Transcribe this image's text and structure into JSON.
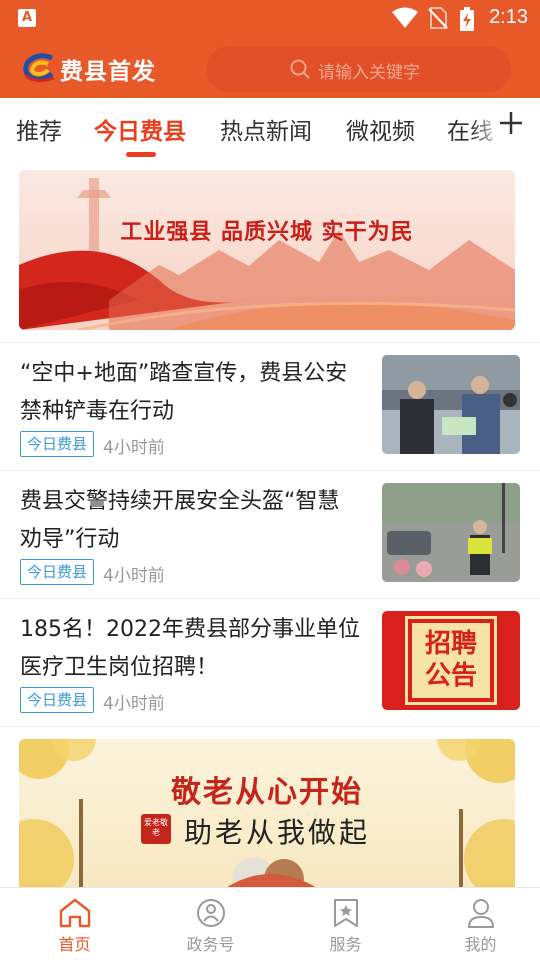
{
  "status_bar": {
    "time": "2:13",
    "icons": [
      "app-notification-icon",
      "wifi-icon",
      "no-sim-icon",
      "battery-charging-icon"
    ]
  },
  "header": {
    "app_name": "费县首发",
    "search_placeholder": "请输入关键字"
  },
  "tabs": [
    {
      "label": "推荐",
      "active": false
    },
    {
      "label": "今日费县",
      "active": true
    },
    {
      "label": "热点新闻",
      "active": false
    },
    {
      "label": "微视频",
      "active": false
    },
    {
      "label": "在线",
      "active": false
    }
  ],
  "banner_top": {
    "slogan": "工业强县 品质兴城 实干为民"
  },
  "news": [
    {
      "title": "“空中+地面”踏查宣传，费县公安禁种铲毒在行动",
      "tag": "今日费县",
      "time_ago": "4小时前"
    },
    {
      "title": "费县交警持续开展安全头盔“智慧劝导”行动",
      "tag": "今日费县",
      "time_ago": "4小时前"
    },
    {
      "title": "185名！2022年费县部分事业单位医疗卫生岗位招聘！",
      "tag": "今日费县",
      "time_ago": "4小时前",
      "thumb_text": [
        "招聘",
        "公告"
      ]
    }
  ],
  "banner_bottom": {
    "line1": "敬老从心开始",
    "line2": "助老从我做起",
    "stamp": "爱老敬老"
  },
  "bottom_nav": [
    {
      "label": "首页",
      "icon": "home-icon",
      "active": true
    },
    {
      "label": "政务号",
      "icon": "government-account-icon",
      "active": false
    },
    {
      "label": "服务",
      "icon": "service-bookmark-icon",
      "active": false
    },
    {
      "label": "我的",
      "icon": "profile-icon",
      "active": false
    }
  ],
  "colors": {
    "brand": "#e8592a",
    "tab_active": "#e8401f",
    "tag_blue": "#3a9be0"
  }
}
